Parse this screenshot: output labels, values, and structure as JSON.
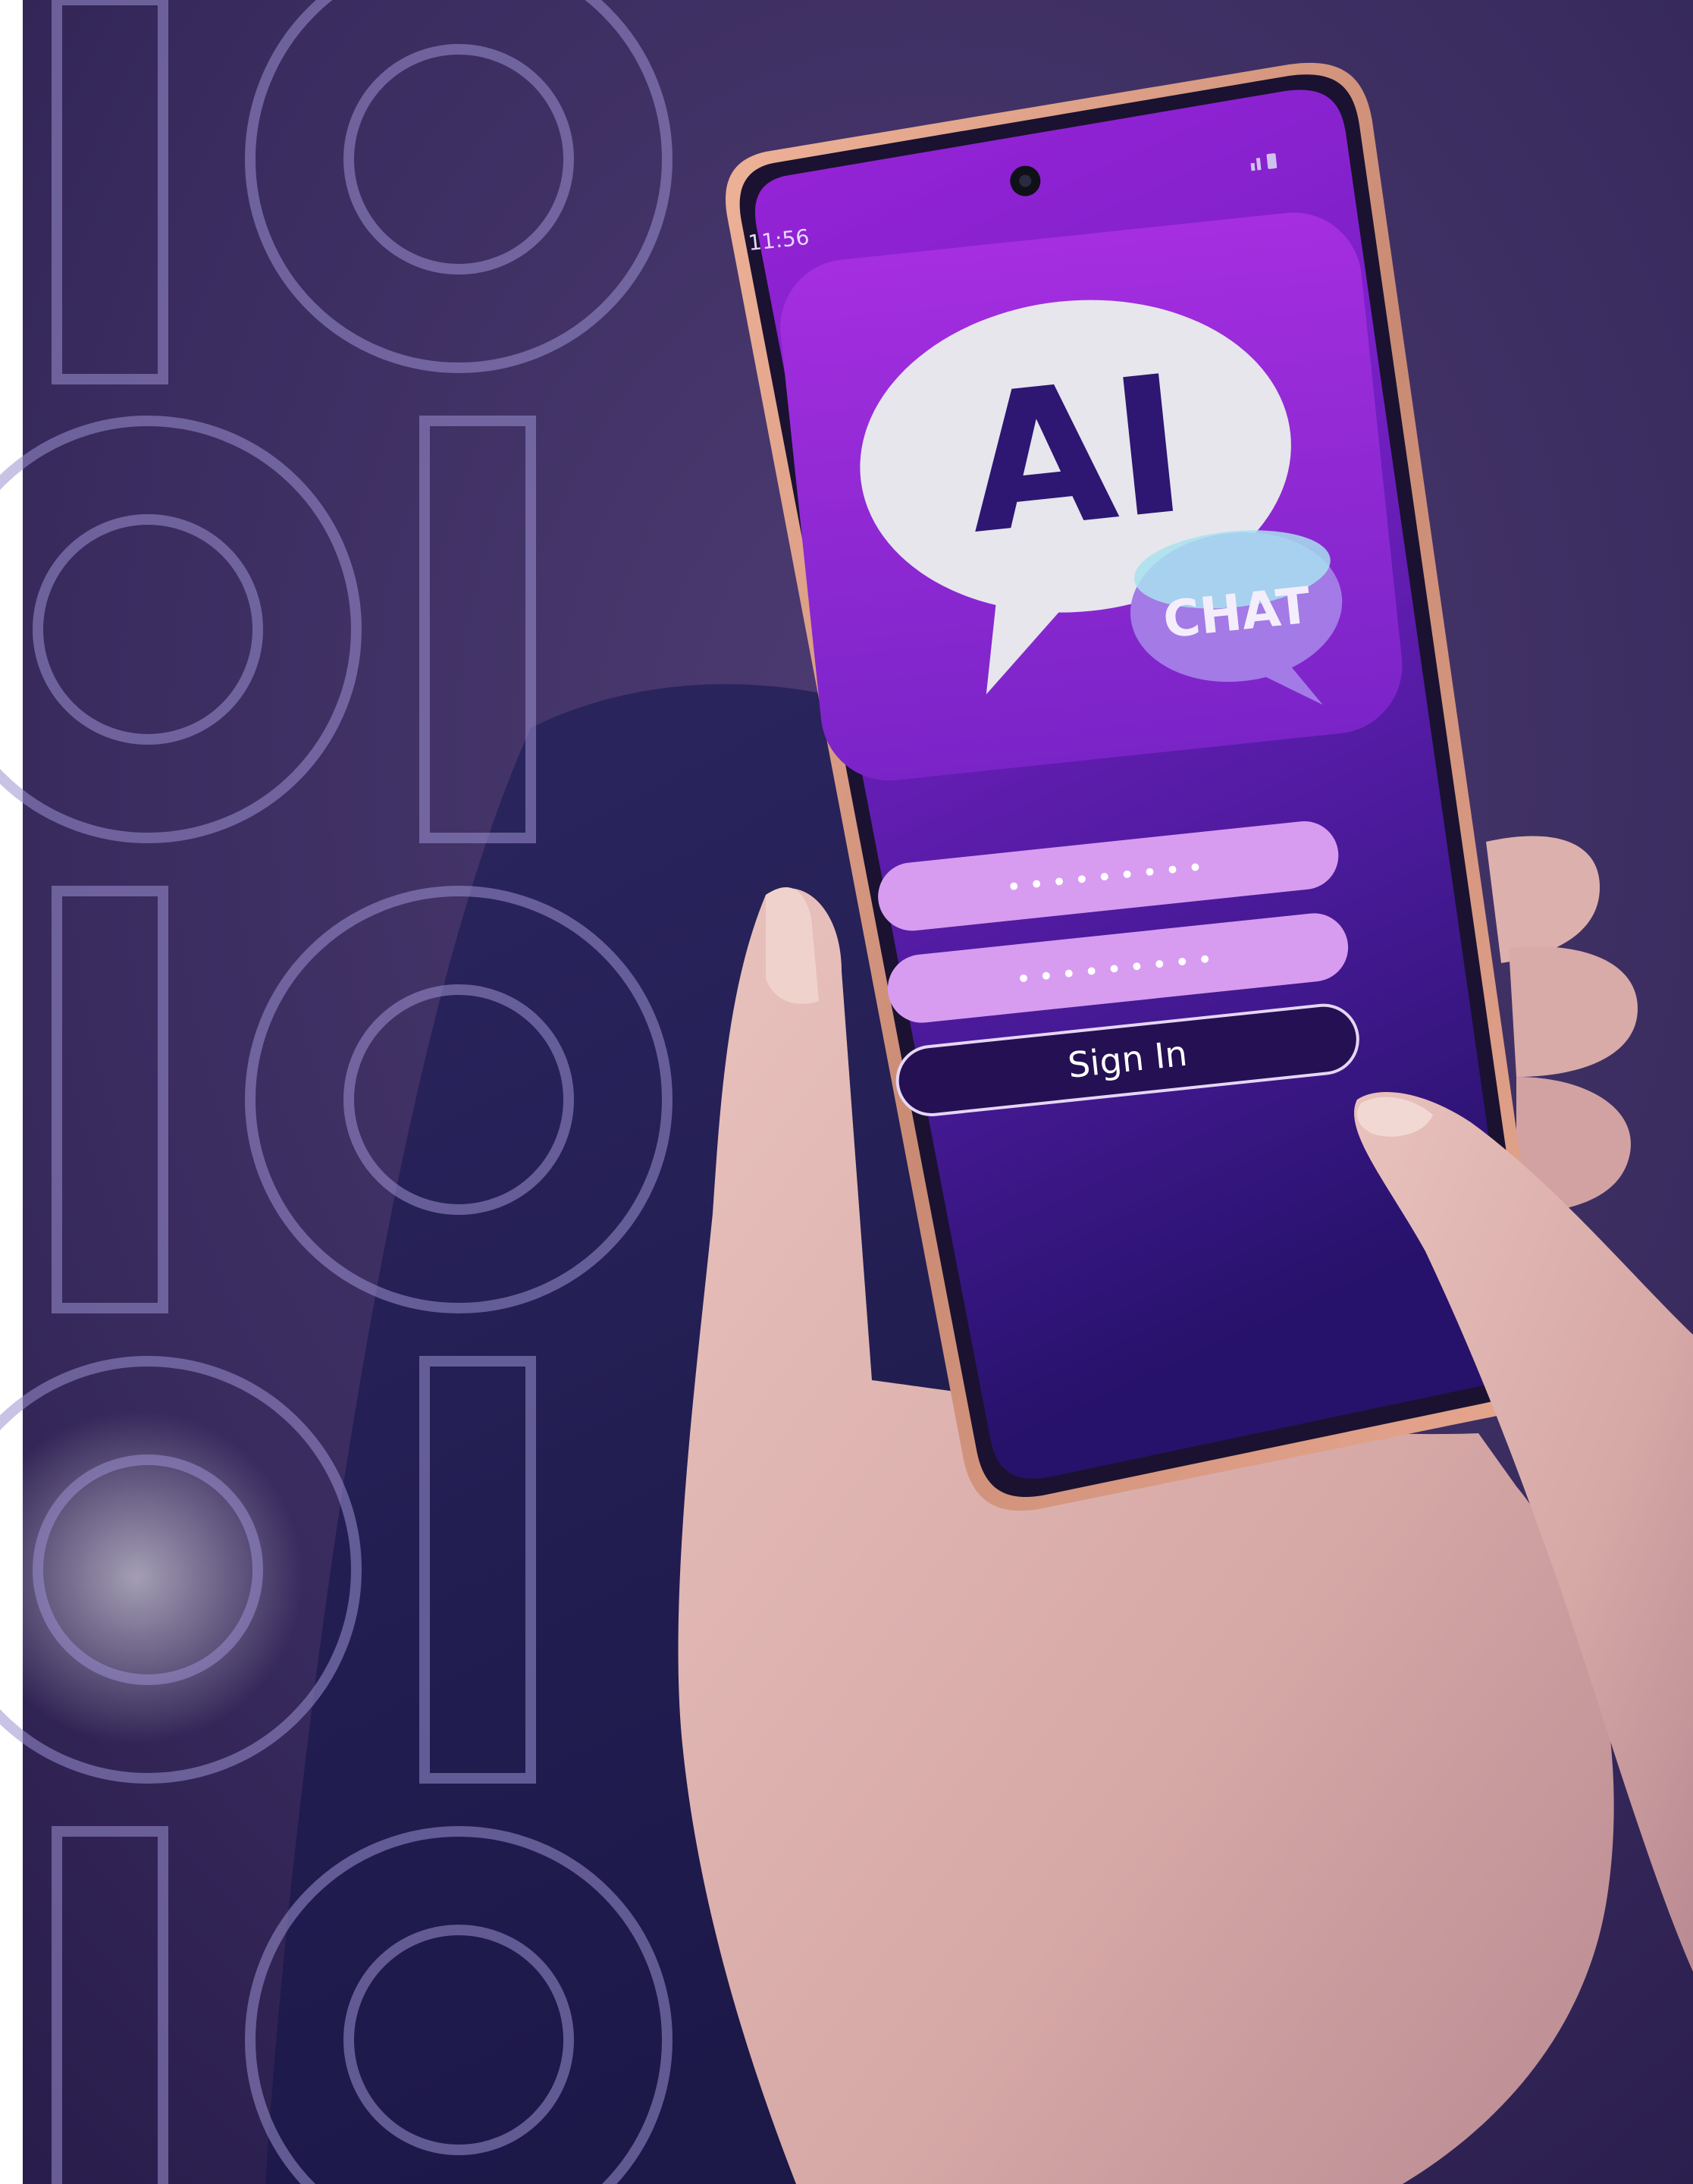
{
  "phone": {
    "status_time": "11:56",
    "logo_primary": "AI",
    "logo_secondary": "CHAT",
    "username_mask": "•••••••••",
    "password_mask": "•••••••••",
    "sign_in_label": "Sign In"
  },
  "colors": {
    "backdrop": "#3a2d5e",
    "screen_top": "#9c27d6",
    "screen_bottom": "#2a1470",
    "bubble_main": "#e6e6ec",
    "bubble_secondary": "#a37ae6",
    "logo_text": "#2e1673",
    "input_fill": "#d79cf0",
    "phone_frame": "#d99a82"
  },
  "icons": [
    "front-camera-icon",
    "signal-icon",
    "battery-icon",
    "binary-pattern-decor"
  ]
}
